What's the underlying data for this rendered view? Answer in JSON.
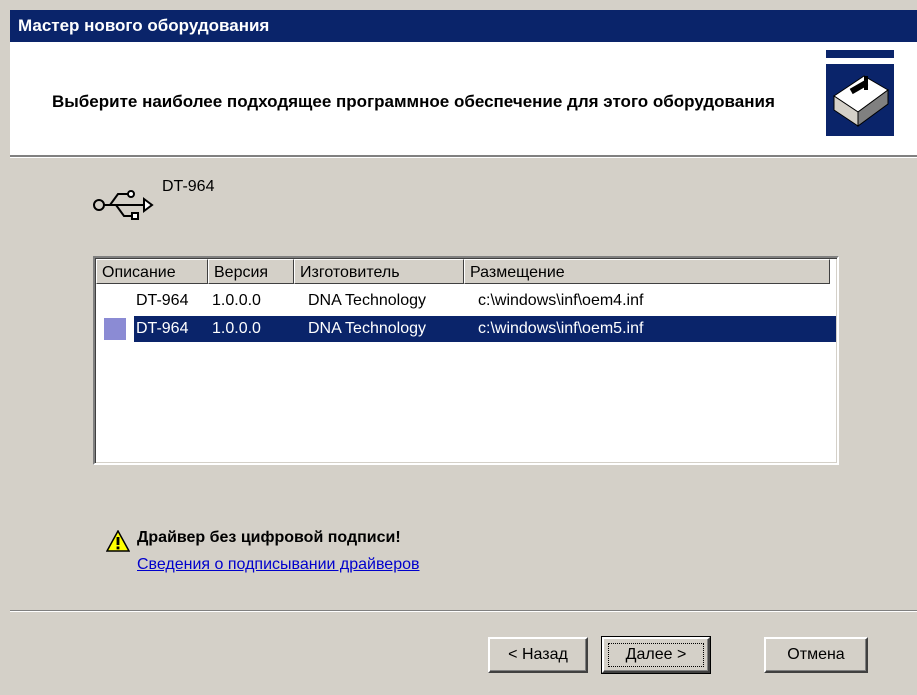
{
  "window": {
    "title": "Мастер нового оборудования"
  },
  "header": {
    "title": "Выберите наиболее подходящее программное обеспечение для этого оборудования",
    "icon": "hardware-install-icon"
  },
  "device": {
    "icon": "usb-icon",
    "name": "DT-964"
  },
  "driver_list": {
    "columns": [
      "Описание",
      "Версия",
      "Изготовитель",
      "Размещение"
    ],
    "rows": [
      {
        "description": "DT-964",
        "version": "1.0.0.0",
        "manufacturer": "DNA Technology",
        "location": "c:\\windows\\inf\\oem4.inf",
        "selected": false
      },
      {
        "description": "DT-964",
        "version": "1.0.0.0",
        "manufacturer": "DNA Technology",
        "location": "c:\\windows\\inf\\oem5.inf",
        "selected": true
      }
    ]
  },
  "warning": {
    "icon": "warning-icon",
    "text": "Драйвер без цифровой подписи!",
    "link": "Сведения о подписывании драйверов"
  },
  "buttons": {
    "back": "< Назад",
    "next": "Далее >",
    "cancel": "Отмена"
  },
  "colors": {
    "titlebar": "#0a246a",
    "selection": "#0a246a",
    "face": "#d4d0c8",
    "link": "#0000cc"
  }
}
